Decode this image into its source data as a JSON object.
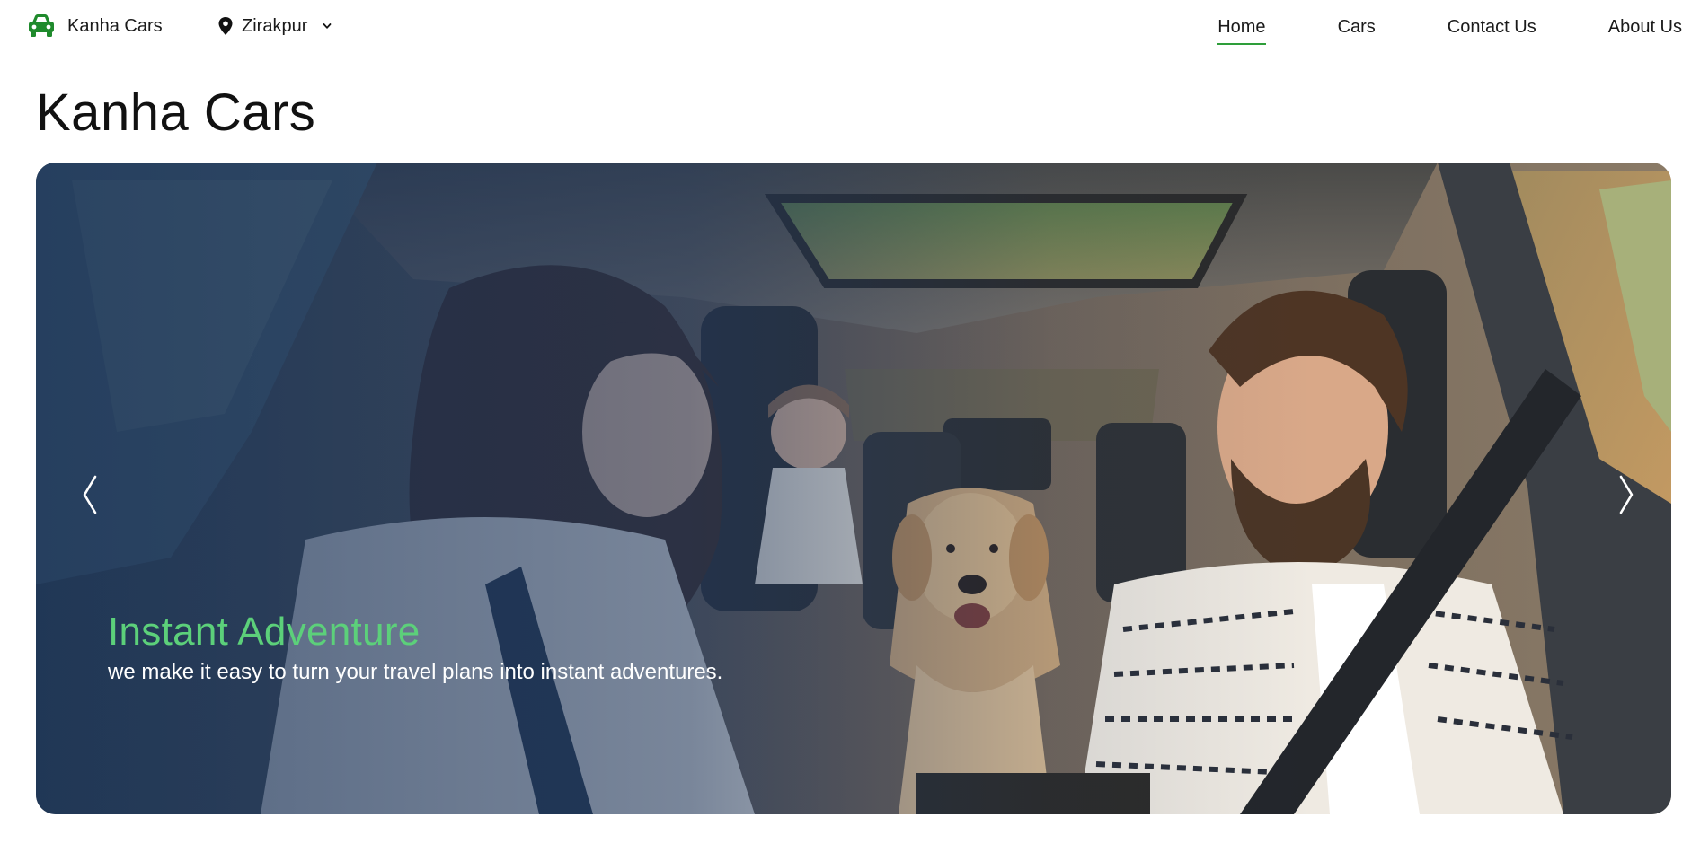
{
  "navbar": {
    "brand_name": "Kanha Cars",
    "brand_icon": "car-icon",
    "location": {
      "name": "Zirakpur",
      "icon": "map-pin-icon",
      "caret_icon": "chevron-down-icon"
    },
    "links": [
      {
        "label": "Home",
        "active": true
      },
      {
        "label": "Cars",
        "active": false
      },
      {
        "label": "Contact Us",
        "active": false
      },
      {
        "label": "About Us",
        "active": false
      }
    ]
  },
  "page": {
    "title": "Kanha Cars"
  },
  "hero": {
    "slide": {
      "title": "Instant Adventure",
      "text": "we make it easy to turn your travel plans into instant adventures."
    },
    "prev_icon": "chevron-left-icon",
    "next_icon": "chevron-right-icon"
  },
  "colors": {
    "accent": "#2e9e3a",
    "caption_title": "#5cd07a",
    "overlay": "#163058"
  }
}
